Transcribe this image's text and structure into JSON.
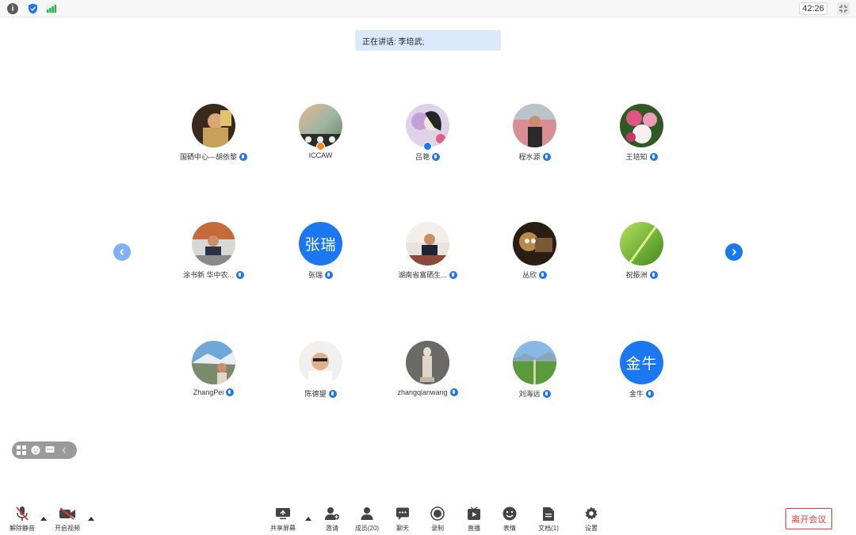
{
  "topbar": {
    "icons": [
      "info-icon",
      "shield-icon",
      "signal-icon"
    ],
    "timer": "42:26",
    "collapse_icon": "collapse-icon"
  },
  "speaking": {
    "text": "正在讲话: 李培武;"
  },
  "participants": [
    {
      "name": "国硒中心—胡依黎",
      "avatar": "photo",
      "role_badge": false
    },
    {
      "name": "ICCAW",
      "avatar": "photo",
      "role_badge": true,
      "badge_color": "#f08a24",
      "mic": false
    },
    {
      "name": "吕艳",
      "avatar": "photo",
      "role_badge": true,
      "badge_color": "#1b78f2"
    },
    {
      "name": "程水源",
      "avatar": "photo",
      "role_badge": false
    },
    {
      "name": "王培知",
      "avatar": "photo",
      "role_badge": false
    },
    {
      "name": "涂书新 华中农...",
      "avatar": "photo",
      "role_badge": false
    },
    {
      "name": "张瑞",
      "avatar": "text",
      "initials": "张瑞",
      "role_badge": false
    },
    {
      "name": "湖南省富硒生...",
      "avatar": "photo",
      "role_badge": false
    },
    {
      "name": "丛欣",
      "avatar": "photo",
      "role_badge": false
    },
    {
      "name": "祝振洲",
      "avatar": "photo",
      "role_badge": false
    },
    {
      "name": "ZhangPei",
      "avatar": "photo",
      "role_badge": false
    },
    {
      "name": "陈德望",
      "avatar": "photo",
      "role_badge": false
    },
    {
      "name": "zhangqianwang",
      "avatar": "photo",
      "role_badge": false
    },
    {
      "name": "刘海远",
      "avatar": "photo",
      "role_badge": false
    },
    {
      "name": "金牛",
      "avatar": "text",
      "initials": "金牛",
      "role_badge": false
    }
  ],
  "toolbar": {
    "unmute": "解除静音",
    "start_video": "开启视频",
    "share_screen": "共享屏幕",
    "invite": "邀请",
    "members": "成员(20)",
    "chat": "聊天",
    "record": "录制",
    "live": "直播",
    "reactions": "表情",
    "docs": "文档(1)",
    "settings": "设置",
    "leave": "离开会议"
  },
  "colors": {
    "accent": "#1b78f2",
    "danger": "#e53935"
  }
}
